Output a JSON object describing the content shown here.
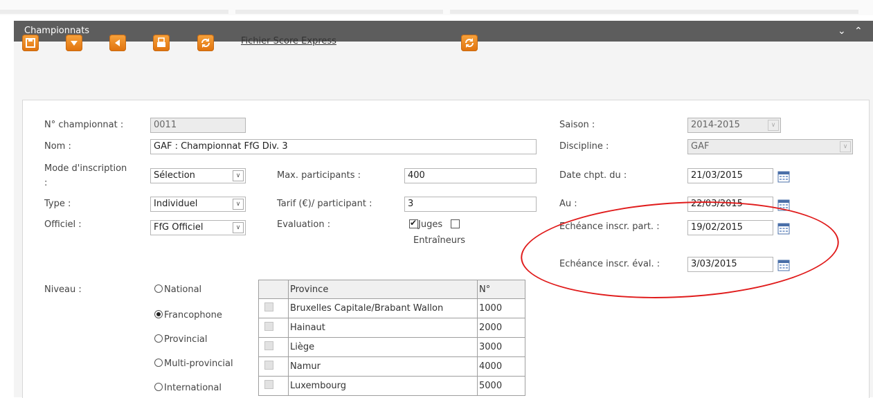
{
  "panel": {
    "title": "Championnats"
  },
  "toolbar": {
    "icons": [
      "save-icon",
      "dropdown-icon",
      "back-icon",
      "print-icon",
      "refresh-icon",
      "sync-icon"
    ],
    "score_express_link": "Fichier Score Express"
  },
  "form": {
    "num_championnat": {
      "label": "N° championnat :",
      "value": "0011"
    },
    "nom": {
      "label": "Nom :",
      "value": "GAF : Championnat FfG Div. 3"
    },
    "mode_inscription": {
      "label_line1": "Mode d'inscription",
      "label_line2": ":",
      "value": "Sélection"
    },
    "type": {
      "label": "Type :",
      "value": "Individuel"
    },
    "officiel": {
      "label": "Officiel :",
      "value": "FfG Officiel"
    },
    "max_participants": {
      "label": "Max. participants :",
      "value": "400"
    },
    "tarif": {
      "label": "Tarif (€)/ participant :",
      "value": "3"
    },
    "evaluation": {
      "label": "Evaluation :",
      "juges": "Juges",
      "juges_checked": true,
      "entraineurs": "Entraîneurs",
      "entraineurs_checked": false
    },
    "saison": {
      "label": "Saison :",
      "value": "2014-2015"
    },
    "discipline": {
      "label": "Discipline :",
      "value": "GAF"
    },
    "date_du": {
      "label": "Date chpt. du :",
      "value": "21/03/2015"
    },
    "date_au": {
      "label": "Au :",
      "value": "22/03/2015"
    },
    "echeance_part": {
      "label": "Echéance inscr. part. :",
      "value": "19/02/2015"
    },
    "echeance_eval": {
      "label": "Echéance inscr. éval. :",
      "value": "3/03/2015"
    },
    "niveau": {
      "label": "Niveau :",
      "options": [
        "National",
        "Francophone",
        "Provincial",
        "Multi-provincial",
        "International"
      ],
      "selected": "Francophone"
    },
    "provinces": {
      "headers": [
        "Province",
        "N°"
      ],
      "rows": [
        {
          "name": "Bruxelles Capitale/Brabant Wallon",
          "num": "1000"
        },
        {
          "name": "Hainaut",
          "num": "2000"
        },
        {
          "name": "Liège",
          "num": "3000"
        },
        {
          "name": "Namur",
          "num": "4000"
        },
        {
          "name": "Luxembourg",
          "num": "5000"
        }
      ]
    }
  },
  "colors": {
    "accent": "#ef8a1e",
    "titlebar": "#5d5d5d",
    "highlight": "#e01b1b"
  }
}
